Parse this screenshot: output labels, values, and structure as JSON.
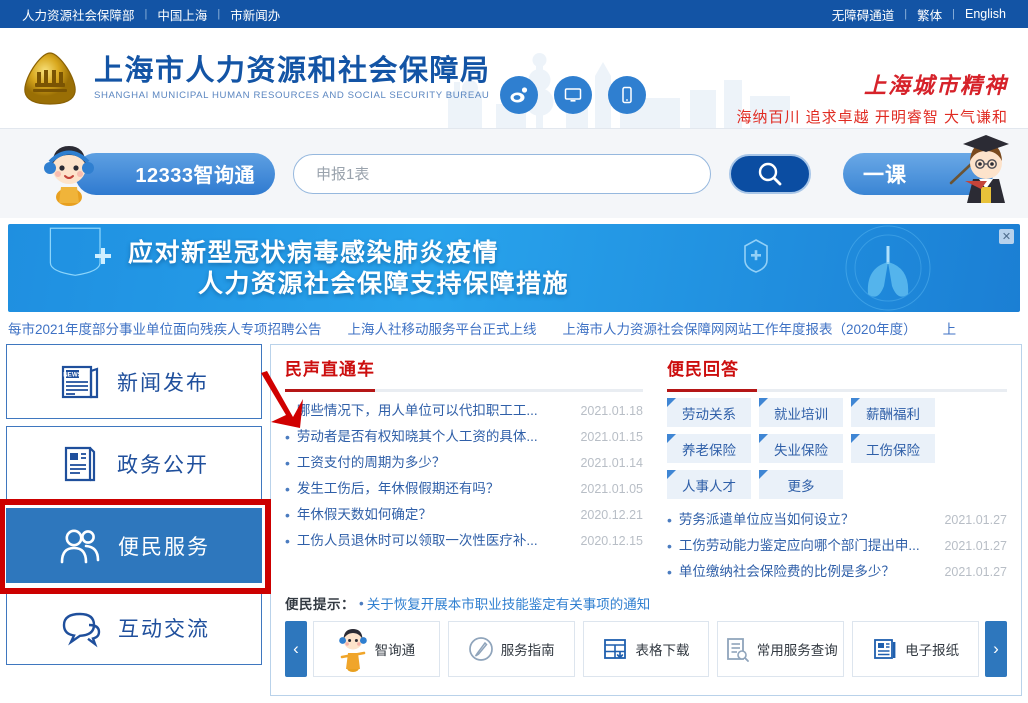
{
  "topbar": {
    "left_links": [
      "人力资源社会保障部",
      "中国上海",
      "市新闻办"
    ],
    "right_links": [
      "无障碍通道",
      "繁体",
      "English"
    ],
    "separator": "|"
  },
  "header": {
    "title_cn": "上海市人力资源和社会保障局",
    "title_en": "SHANGHAI MUNICIPAL HUMAN RESOURCES AND SOCIAL SECURITY BUREAU",
    "social_icons": [
      "weibo-icon",
      "desktop-icon",
      "mobile-icon"
    ],
    "spirit_title": "上海城市精神",
    "spirit_slogan": "海纳百川 追求卓越 开明睿智 大气谦和"
  },
  "search": {
    "zxt_label": "12333智询通",
    "input_value": "申报1表",
    "placeholder": "申报1表",
    "search_icon": "magnifier-icon",
    "yike_label": "一课"
  },
  "banner": {
    "line1": "应对新型冠状病毒感染肺炎疫情",
    "line2": "人力资源社会保障支持保障措施",
    "close_label": "✕"
  },
  "ticker": {
    "items": [
      "每市2021年度部分事业单位面向残疾人专项招聘公告",
      "上海人社移动服务平台正式上线",
      "上海市人力资源社会保障网网站工作年度报表（2020年度）",
      "上"
    ]
  },
  "sidebar": {
    "items": [
      {
        "label": "新闻发布",
        "icon": "newspaper-icon",
        "active": false
      },
      {
        "label": "政务公开",
        "icon": "document-icon",
        "active": false
      },
      {
        "label": "便民服务",
        "icon": "people-icon",
        "active": true
      },
      {
        "label": "互动交流",
        "icon": "chat-bubbles-icon",
        "active": false
      }
    ]
  },
  "left_panel": {
    "title": "民声直通车",
    "items": [
      {
        "text": "哪些情况下，用人单位可以代扣职工工...",
        "date": "2021.01.18"
      },
      {
        "text": "劳动者是否有权知晓其个人工资的具体...",
        "date": "2021.01.15"
      },
      {
        "text": "工资支付的周期为多少？",
        "date": "2021.01.14"
      },
      {
        "text": "发生工伤后，年休假假期还有吗？",
        "date": "2021.01.05"
      },
      {
        "text": "年休假天数如何确定？",
        "date": "2020.12.21"
      },
      {
        "text": "工伤人员退休时可以领取一次性医疗补...",
        "date": "2020.12.15"
      }
    ]
  },
  "right_panel": {
    "title": "便民回答",
    "tags": [
      "劳动关系",
      "就业培训",
      "薪酬福利",
      "养老保险",
      "失业保险",
      "工伤保险",
      "人事人才",
      "更多"
    ],
    "items": [
      {
        "text": "劳务派遣单位应当如何设立？",
        "date": "2021.01.27"
      },
      {
        "text": "工伤劳动能力鉴定应向哪个部门提出申...",
        "date": "2021.01.27"
      },
      {
        "text": "单位缴纳社会保险费的比例是多少？",
        "date": "2021.01.27"
      }
    ]
  },
  "tip": {
    "label": "便民提示：",
    "dot": "•",
    "link": "关于恢复开展本市职业技能鉴定有关事项的通知"
  },
  "services": {
    "prev_label": "‹",
    "next_label": "›",
    "cards": [
      {
        "label": "智询通",
        "icon": "mascot-icon"
      },
      {
        "label": "服务指南",
        "icon": "pen-circle-icon"
      },
      {
        "label": "表格下载",
        "icon": "form-download-icon"
      },
      {
        "label": "常用服务查询",
        "icon": "doc-search-icon"
      },
      {
        "label": "电子报纸",
        "icon": "newspaper-small-icon"
      }
    ]
  },
  "colors": {
    "brand_blue": "#1354a5",
    "accent_blue": "#2e77bd",
    "title_red": "#cc0e0e",
    "annotation_red": "#cc0000",
    "banner_blue": "#28a3ec"
  }
}
